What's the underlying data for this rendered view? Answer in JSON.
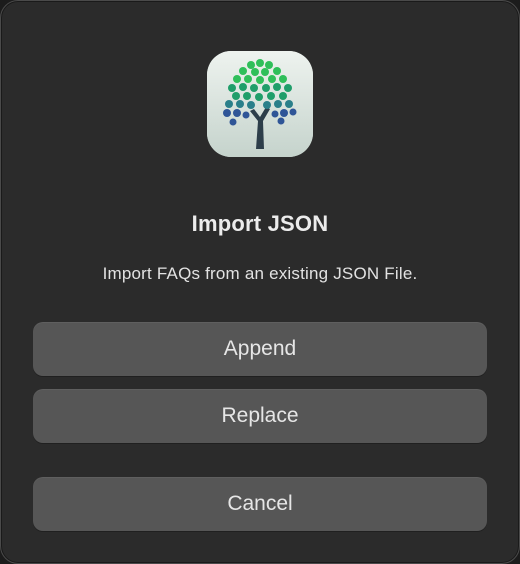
{
  "dialog": {
    "app_icon": "tree-app-icon",
    "title": "Import JSON",
    "message": "Import FAQs from an existing JSON File.",
    "buttons": {
      "append_label": "Append",
      "replace_label": "Replace",
      "cancel_label": "Cancel"
    }
  },
  "colors": {
    "dialog_background": "#2b2b2b",
    "button_background": "#565656",
    "text": "#e6e6e6"
  }
}
